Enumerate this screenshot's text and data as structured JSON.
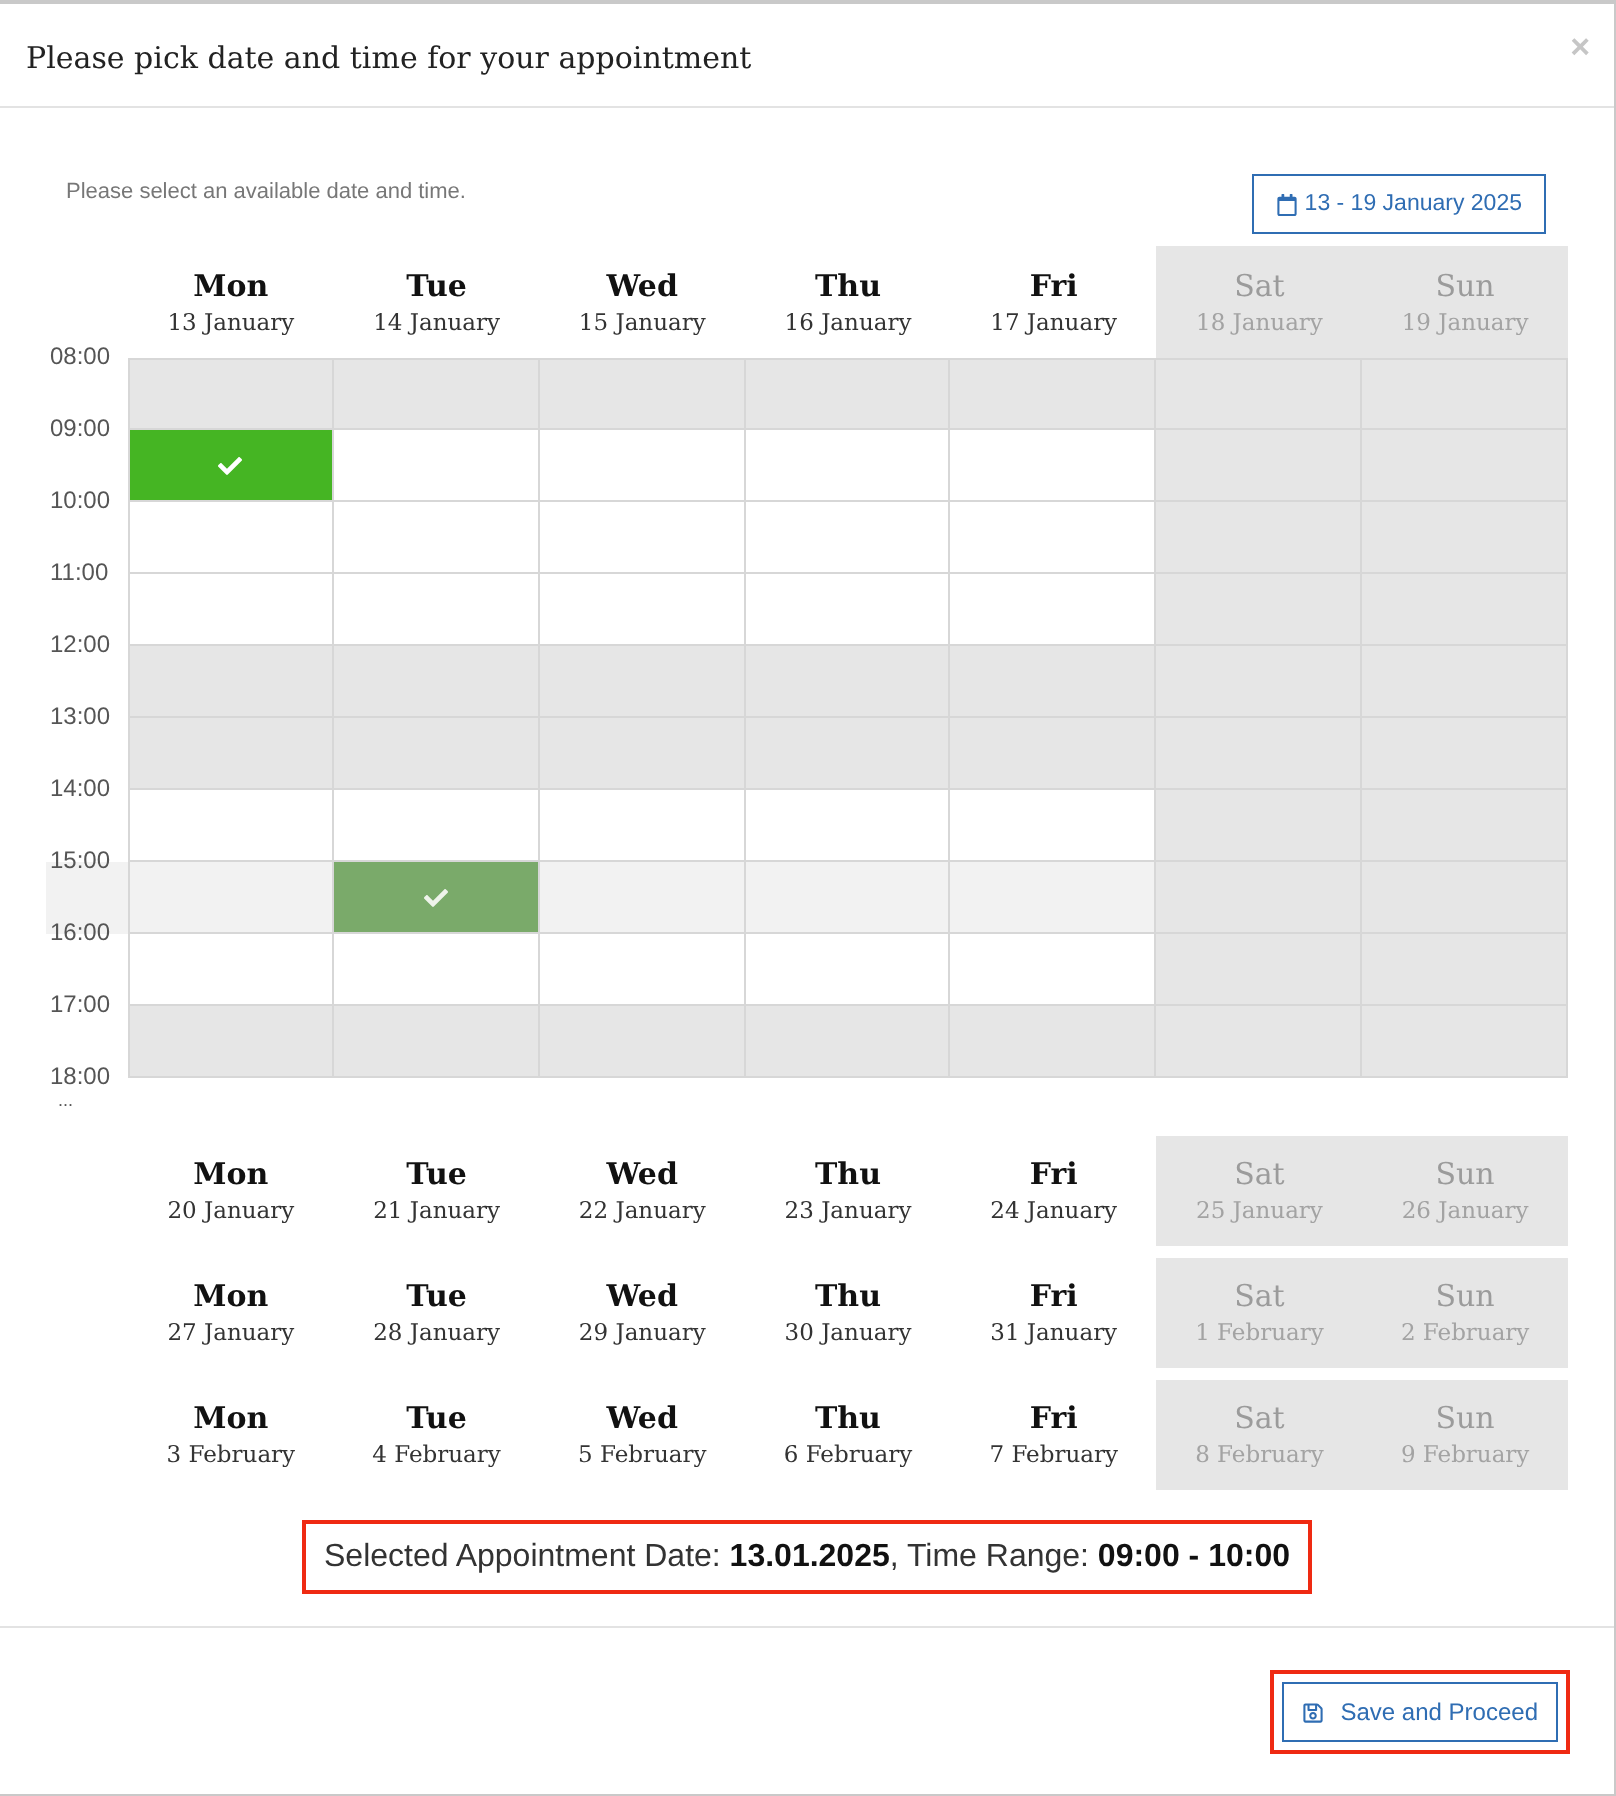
{
  "dialog": {
    "title": "Please pick date and time for your appointment",
    "close": "×"
  },
  "hint": "Please select an available date and time.",
  "week_button": {
    "label": "13 - 19 January 2025"
  },
  "current_week": {
    "days": [
      {
        "name": "Mon",
        "date": "13 January",
        "weekend": false
      },
      {
        "name": "Tue",
        "date": "14 January",
        "weekend": false
      },
      {
        "name": "Wed",
        "date": "15 January",
        "weekend": false
      },
      {
        "name": "Thu",
        "date": "16 January",
        "weekend": false
      },
      {
        "name": "Fri",
        "date": "17 January",
        "weekend": false
      },
      {
        "name": "Sat",
        "date": "18 January",
        "weekend": true
      },
      {
        "name": "Sun",
        "date": "19 January",
        "weekend": true
      }
    ],
    "rows": [
      {
        "time": "08:00",
        "hovered": false,
        "cells": [
          {
            "available": false,
            "checked": false
          },
          {
            "available": false,
            "checked": false
          },
          {
            "available": false,
            "checked": false
          },
          {
            "available": false,
            "checked": false
          },
          {
            "available": false,
            "checked": false
          }
        ]
      },
      {
        "time": "09:00",
        "hovered": false,
        "cells": [
          {
            "available": true,
            "checked": true
          },
          {
            "available": true,
            "checked": false
          },
          {
            "available": true,
            "checked": false
          },
          {
            "available": true,
            "checked": false
          },
          {
            "available": true,
            "checked": false
          }
        ]
      },
      {
        "time": "10:00",
        "hovered": false,
        "cells": [
          {
            "available": true,
            "checked": false
          },
          {
            "available": true,
            "checked": false
          },
          {
            "available": true,
            "checked": false
          },
          {
            "available": true,
            "checked": false
          },
          {
            "available": true,
            "checked": false
          }
        ]
      },
      {
        "time": "11:00",
        "hovered": false,
        "cells": [
          {
            "available": true,
            "checked": false
          },
          {
            "available": true,
            "checked": false
          },
          {
            "available": true,
            "checked": false
          },
          {
            "available": true,
            "checked": false
          },
          {
            "available": true,
            "checked": false
          }
        ]
      },
      {
        "time": "12:00",
        "hovered": false,
        "cells": [
          {
            "available": false,
            "checked": false
          },
          {
            "available": false,
            "checked": false
          },
          {
            "available": false,
            "checked": false
          },
          {
            "available": false,
            "checked": false
          },
          {
            "available": false,
            "checked": false
          }
        ]
      },
      {
        "time": "13:00",
        "hovered": false,
        "cells": [
          {
            "available": false,
            "checked": false
          },
          {
            "available": false,
            "checked": false
          },
          {
            "available": false,
            "checked": false
          },
          {
            "available": false,
            "checked": false
          },
          {
            "available": false,
            "checked": false
          }
        ]
      },
      {
        "time": "14:00",
        "hovered": false,
        "cells": [
          {
            "available": true,
            "checked": false
          },
          {
            "available": true,
            "checked": false
          },
          {
            "available": true,
            "checked": false
          },
          {
            "available": true,
            "checked": false
          },
          {
            "available": true,
            "checked": false
          }
        ]
      },
      {
        "time": "15:00",
        "hovered": true,
        "cells": [
          {
            "available": true,
            "checked": false
          },
          {
            "available": true,
            "checked": true
          },
          {
            "available": true,
            "checked": false
          },
          {
            "available": true,
            "checked": false
          },
          {
            "available": true,
            "checked": false
          }
        ]
      },
      {
        "time": "16:00",
        "hovered": false,
        "cells": [
          {
            "available": true,
            "checked": false
          },
          {
            "available": true,
            "checked": false
          },
          {
            "available": true,
            "checked": false
          },
          {
            "available": true,
            "checked": false
          },
          {
            "available": true,
            "checked": false
          }
        ]
      },
      {
        "time": "17:00",
        "hovered": false,
        "cells": [
          {
            "available": false,
            "checked": false
          },
          {
            "available": false,
            "checked": false
          },
          {
            "available": false,
            "checked": false
          },
          {
            "available": false,
            "checked": false
          },
          {
            "available": false,
            "checked": false
          }
        ]
      }
    ],
    "end_time": "18:00",
    "more": "..."
  },
  "next_weeks": [
    {
      "days": [
        {
          "name": "Mon",
          "date": "20 January",
          "weekend": false
        },
        {
          "name": "Tue",
          "date": "21 January",
          "weekend": false
        },
        {
          "name": "Wed",
          "date": "22 January",
          "weekend": false
        },
        {
          "name": "Thu",
          "date": "23 January",
          "weekend": false
        },
        {
          "name": "Fri",
          "date": "24 January",
          "weekend": false
        },
        {
          "name": "Sat",
          "date": "25 January",
          "weekend": true
        },
        {
          "name": "Sun",
          "date": "26 January",
          "weekend": true
        }
      ]
    },
    {
      "days": [
        {
          "name": "Mon",
          "date": "27 January",
          "weekend": false
        },
        {
          "name": "Tue",
          "date": "28 January",
          "weekend": false
        },
        {
          "name": "Wed",
          "date": "29 January",
          "weekend": false
        },
        {
          "name": "Thu",
          "date": "30 January",
          "weekend": false
        },
        {
          "name": "Fri",
          "date": "31 January",
          "weekend": false
        },
        {
          "name": "Sat",
          "date": "1 February",
          "weekend": true
        },
        {
          "name": "Sun",
          "date": "2 February",
          "weekend": true
        }
      ]
    },
    {
      "days": [
        {
          "name": "Mon",
          "date": "3 February",
          "weekend": false
        },
        {
          "name": "Tue",
          "date": "4 February",
          "weekend": false
        },
        {
          "name": "Wed",
          "date": "5 February",
          "weekend": false
        },
        {
          "name": "Thu",
          "date": "6 February",
          "weekend": false
        },
        {
          "name": "Fri",
          "date": "7 February",
          "weekend": false
        },
        {
          "name": "Sat",
          "date": "8 February",
          "weekend": true
        },
        {
          "name": "Sun",
          "date": "9 February",
          "weekend": true
        }
      ]
    }
  ],
  "summary": {
    "text": "Selected Appointment Date: **13.01.2025**, Time Range: **09:00 - 10:00**",
    "highlighted": true
  },
  "save_button": {
    "label": "Save and Proceed",
    "highlighted": true
  }
}
